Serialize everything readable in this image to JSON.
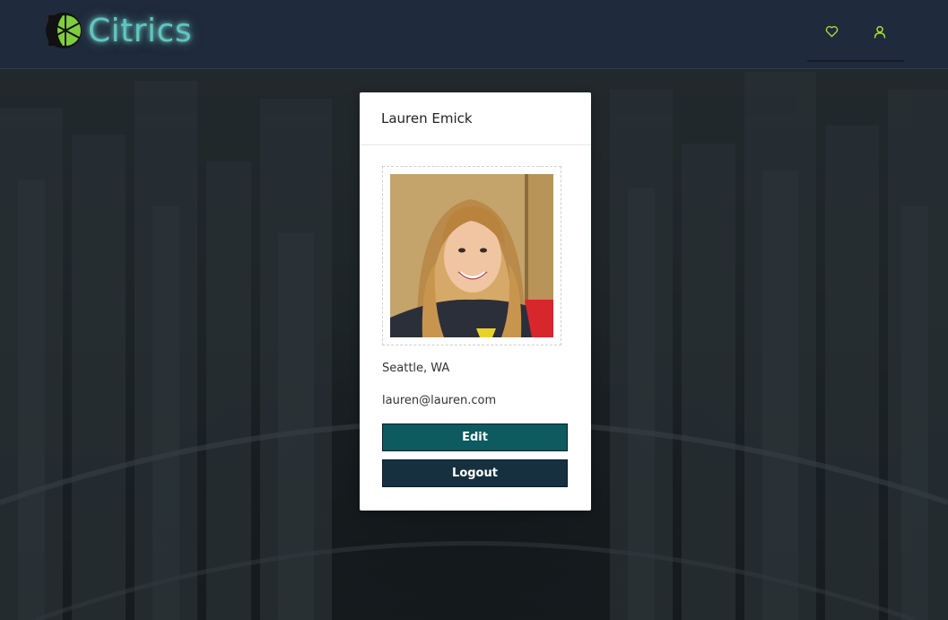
{
  "header": {
    "logo_text": "Citrics",
    "nav": [
      {
        "icon": "heart-icon"
      },
      {
        "icon": "user-icon"
      }
    ],
    "accent_color": "#a6e22e"
  },
  "profile": {
    "name": "Lauren Emick",
    "location": "Seattle, WA",
    "email": "lauren@lauren.com",
    "edit_label": "Edit",
    "logout_label": "Logout",
    "edit_color": "#0d5a5f",
    "logout_color": "#16303f"
  }
}
